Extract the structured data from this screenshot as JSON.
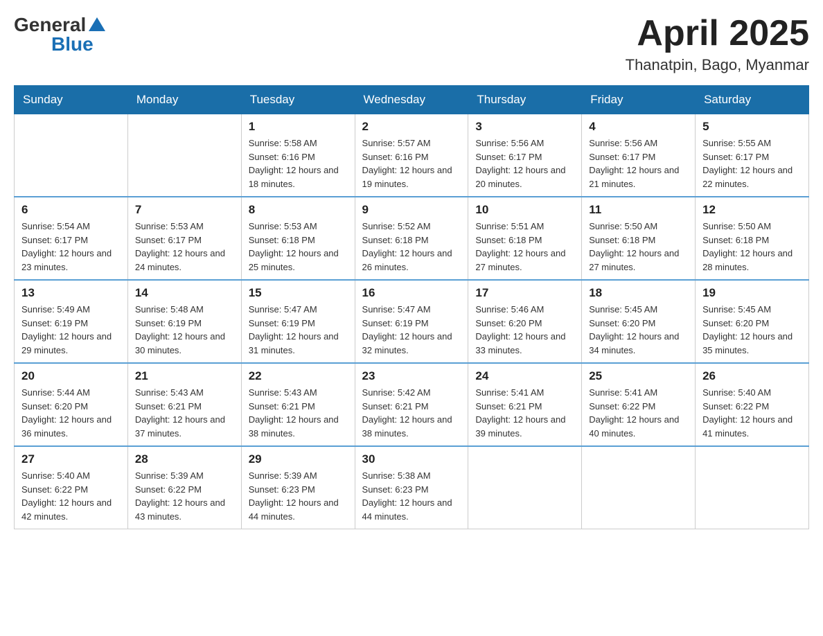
{
  "logo": {
    "text_general": "General",
    "text_blue": "Blue"
  },
  "title": {
    "month": "April 2025",
    "location": "Thanatpin, Bago, Myanmar"
  },
  "weekdays": [
    "Sunday",
    "Monday",
    "Tuesday",
    "Wednesday",
    "Thursday",
    "Friday",
    "Saturday"
  ],
  "weeks": [
    [
      {
        "day": "",
        "sunrise": "",
        "sunset": "",
        "daylight": ""
      },
      {
        "day": "",
        "sunrise": "",
        "sunset": "",
        "daylight": ""
      },
      {
        "day": "1",
        "sunrise": "Sunrise: 5:58 AM",
        "sunset": "Sunset: 6:16 PM",
        "daylight": "Daylight: 12 hours and 18 minutes."
      },
      {
        "day": "2",
        "sunrise": "Sunrise: 5:57 AM",
        "sunset": "Sunset: 6:16 PM",
        "daylight": "Daylight: 12 hours and 19 minutes."
      },
      {
        "day": "3",
        "sunrise": "Sunrise: 5:56 AM",
        "sunset": "Sunset: 6:17 PM",
        "daylight": "Daylight: 12 hours and 20 minutes."
      },
      {
        "day": "4",
        "sunrise": "Sunrise: 5:56 AM",
        "sunset": "Sunset: 6:17 PM",
        "daylight": "Daylight: 12 hours and 21 minutes."
      },
      {
        "day": "5",
        "sunrise": "Sunrise: 5:55 AM",
        "sunset": "Sunset: 6:17 PM",
        "daylight": "Daylight: 12 hours and 22 minutes."
      }
    ],
    [
      {
        "day": "6",
        "sunrise": "Sunrise: 5:54 AM",
        "sunset": "Sunset: 6:17 PM",
        "daylight": "Daylight: 12 hours and 23 minutes."
      },
      {
        "day": "7",
        "sunrise": "Sunrise: 5:53 AM",
        "sunset": "Sunset: 6:17 PM",
        "daylight": "Daylight: 12 hours and 24 minutes."
      },
      {
        "day": "8",
        "sunrise": "Sunrise: 5:53 AM",
        "sunset": "Sunset: 6:18 PM",
        "daylight": "Daylight: 12 hours and 25 minutes."
      },
      {
        "day": "9",
        "sunrise": "Sunrise: 5:52 AM",
        "sunset": "Sunset: 6:18 PM",
        "daylight": "Daylight: 12 hours and 26 minutes."
      },
      {
        "day": "10",
        "sunrise": "Sunrise: 5:51 AM",
        "sunset": "Sunset: 6:18 PM",
        "daylight": "Daylight: 12 hours and 27 minutes."
      },
      {
        "day": "11",
        "sunrise": "Sunrise: 5:50 AM",
        "sunset": "Sunset: 6:18 PM",
        "daylight": "Daylight: 12 hours and 27 minutes."
      },
      {
        "day": "12",
        "sunrise": "Sunrise: 5:50 AM",
        "sunset": "Sunset: 6:18 PM",
        "daylight": "Daylight: 12 hours and 28 minutes."
      }
    ],
    [
      {
        "day": "13",
        "sunrise": "Sunrise: 5:49 AM",
        "sunset": "Sunset: 6:19 PM",
        "daylight": "Daylight: 12 hours and 29 minutes."
      },
      {
        "day": "14",
        "sunrise": "Sunrise: 5:48 AM",
        "sunset": "Sunset: 6:19 PM",
        "daylight": "Daylight: 12 hours and 30 minutes."
      },
      {
        "day": "15",
        "sunrise": "Sunrise: 5:47 AM",
        "sunset": "Sunset: 6:19 PM",
        "daylight": "Daylight: 12 hours and 31 minutes."
      },
      {
        "day": "16",
        "sunrise": "Sunrise: 5:47 AM",
        "sunset": "Sunset: 6:19 PM",
        "daylight": "Daylight: 12 hours and 32 minutes."
      },
      {
        "day": "17",
        "sunrise": "Sunrise: 5:46 AM",
        "sunset": "Sunset: 6:20 PM",
        "daylight": "Daylight: 12 hours and 33 minutes."
      },
      {
        "day": "18",
        "sunrise": "Sunrise: 5:45 AM",
        "sunset": "Sunset: 6:20 PM",
        "daylight": "Daylight: 12 hours and 34 minutes."
      },
      {
        "day": "19",
        "sunrise": "Sunrise: 5:45 AM",
        "sunset": "Sunset: 6:20 PM",
        "daylight": "Daylight: 12 hours and 35 minutes."
      }
    ],
    [
      {
        "day": "20",
        "sunrise": "Sunrise: 5:44 AM",
        "sunset": "Sunset: 6:20 PM",
        "daylight": "Daylight: 12 hours and 36 minutes."
      },
      {
        "day": "21",
        "sunrise": "Sunrise: 5:43 AM",
        "sunset": "Sunset: 6:21 PM",
        "daylight": "Daylight: 12 hours and 37 minutes."
      },
      {
        "day": "22",
        "sunrise": "Sunrise: 5:43 AM",
        "sunset": "Sunset: 6:21 PM",
        "daylight": "Daylight: 12 hours and 38 minutes."
      },
      {
        "day": "23",
        "sunrise": "Sunrise: 5:42 AM",
        "sunset": "Sunset: 6:21 PM",
        "daylight": "Daylight: 12 hours and 38 minutes."
      },
      {
        "day": "24",
        "sunrise": "Sunrise: 5:41 AM",
        "sunset": "Sunset: 6:21 PM",
        "daylight": "Daylight: 12 hours and 39 minutes."
      },
      {
        "day": "25",
        "sunrise": "Sunrise: 5:41 AM",
        "sunset": "Sunset: 6:22 PM",
        "daylight": "Daylight: 12 hours and 40 minutes."
      },
      {
        "day": "26",
        "sunrise": "Sunrise: 5:40 AM",
        "sunset": "Sunset: 6:22 PM",
        "daylight": "Daylight: 12 hours and 41 minutes."
      }
    ],
    [
      {
        "day": "27",
        "sunrise": "Sunrise: 5:40 AM",
        "sunset": "Sunset: 6:22 PM",
        "daylight": "Daylight: 12 hours and 42 minutes."
      },
      {
        "day": "28",
        "sunrise": "Sunrise: 5:39 AM",
        "sunset": "Sunset: 6:22 PM",
        "daylight": "Daylight: 12 hours and 43 minutes."
      },
      {
        "day": "29",
        "sunrise": "Sunrise: 5:39 AM",
        "sunset": "Sunset: 6:23 PM",
        "daylight": "Daylight: 12 hours and 44 minutes."
      },
      {
        "day": "30",
        "sunrise": "Sunrise: 5:38 AM",
        "sunset": "Sunset: 6:23 PM",
        "daylight": "Daylight: 12 hours and 44 minutes."
      },
      {
        "day": "",
        "sunrise": "",
        "sunset": "",
        "daylight": ""
      },
      {
        "day": "",
        "sunrise": "",
        "sunset": "",
        "daylight": ""
      },
      {
        "day": "",
        "sunrise": "",
        "sunset": "",
        "daylight": ""
      }
    ]
  ]
}
